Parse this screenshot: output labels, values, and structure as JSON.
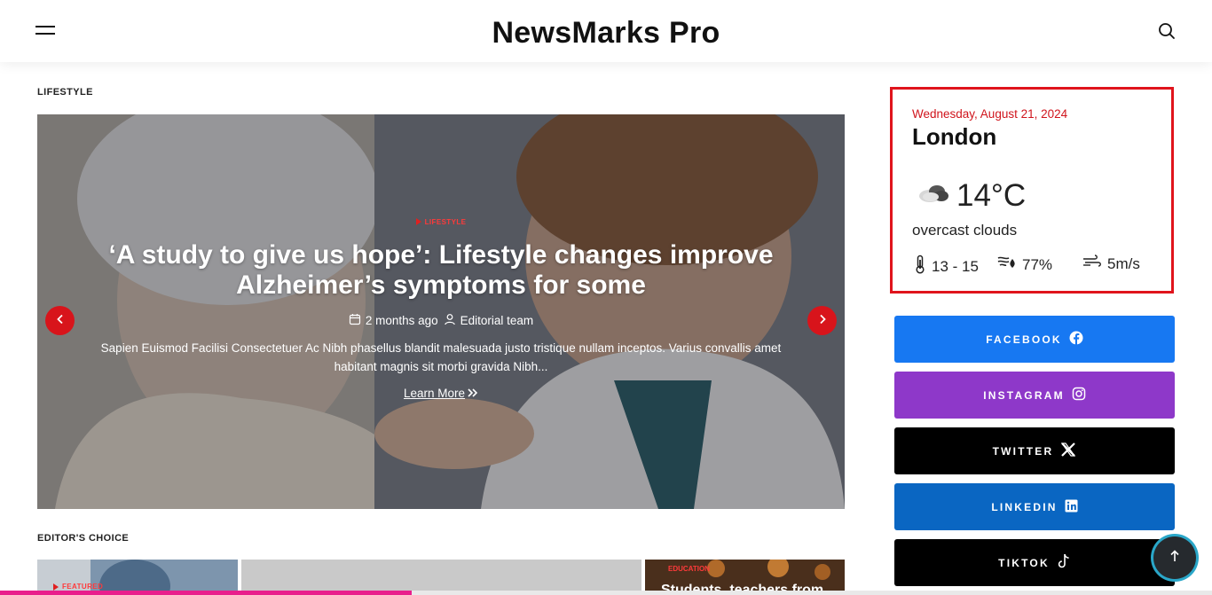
{
  "header": {
    "site_title": "NewsMarks Pro"
  },
  "lifestyle_section": {
    "label": "LIFESTYLE"
  },
  "hero": {
    "category": "LIFESTYLE",
    "title": "‘A study to give us hope’: Lifestyle changes improve Alzheimer’s symptoms for some",
    "time_ago": "2 months ago",
    "author": "Editorial team",
    "excerpt": "Sapien Euismod Facilisi Consectetuer Ac Nibh phasellus blandit malesuada justo tristique nullam inceptos. Varius convallis amet habitant magnis sit morbi gravida Nibh...",
    "learn_more": "Learn More"
  },
  "editors_choice": {
    "label": "EDITOR'S CHOICE",
    "items": [
      {
        "badge": "FEATURED"
      },
      {
        "badge": ""
      },
      {
        "badge": "EDUCATION",
        "title": "Students, teachers from"
      }
    ]
  },
  "weather": {
    "date": "Wednesday, August 21, 2024",
    "city": "London",
    "temperature": "14°C",
    "description": "overcast clouds",
    "temp_range": "13 - 15",
    "humidity": "77%",
    "wind": "5m/s"
  },
  "social": {
    "facebook": "FACEBOOK",
    "instagram": "INSTAGRAM",
    "twitter": "TWITTER",
    "linkedin": "LINKEDIN",
    "tiktok": "TIKTOK"
  },
  "reading_progress": 0.34,
  "colors": {
    "accent_red": "#e0141c",
    "facebook": "#1778f2",
    "instagram": "#8e38c9",
    "twitter": "#000000",
    "linkedin": "#0a66c2",
    "tiktok": "#000000",
    "progress": "#e91e8c"
  },
  "icons": {
    "menu": "hamburger-icon",
    "search": "search-icon",
    "prev": "chevron-left-icon",
    "next": "chevron-right-icon",
    "calendar": "calendar-icon",
    "user": "user-icon",
    "learn_more": "double-chevron-right-icon",
    "weather": "cloud-icon",
    "thermometer": "thermometer-icon",
    "humidity": "humidity-icon",
    "wind": "wind-icon",
    "scroll_top": "arrow-up-icon"
  }
}
